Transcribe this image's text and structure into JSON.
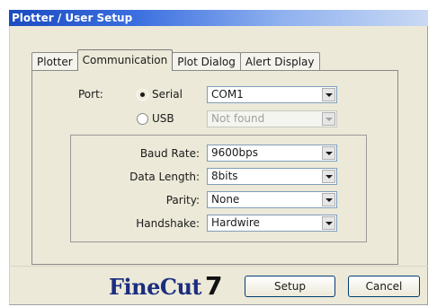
{
  "window": {
    "title": "Plotter / User Setup"
  },
  "tabs": [
    {
      "label": "Plotter",
      "active": false
    },
    {
      "label": "Communication",
      "active": true
    },
    {
      "label": "Plot Dialog",
      "active": false
    },
    {
      "label": "Alert Display",
      "active": false
    }
  ],
  "port": {
    "label": "Port:",
    "serial": {
      "label": "Serial",
      "checked": true,
      "value": "COM1"
    },
    "usb": {
      "label": "USB",
      "checked": false,
      "value": "Not found",
      "enabled": false
    }
  },
  "settings": {
    "baud_rate": {
      "label": "Baud Rate:",
      "value": "9600bps"
    },
    "data_length": {
      "label": "Data Length:",
      "value": "8bits"
    },
    "parity": {
      "label": "Parity:",
      "value": "None"
    },
    "handshake": {
      "label": "Handshake:",
      "value": "Hardwire"
    }
  },
  "logo": {
    "text": "FineCut",
    "number": "7"
  },
  "buttons": {
    "setup": "Setup",
    "cancel": "Cancel"
  }
}
